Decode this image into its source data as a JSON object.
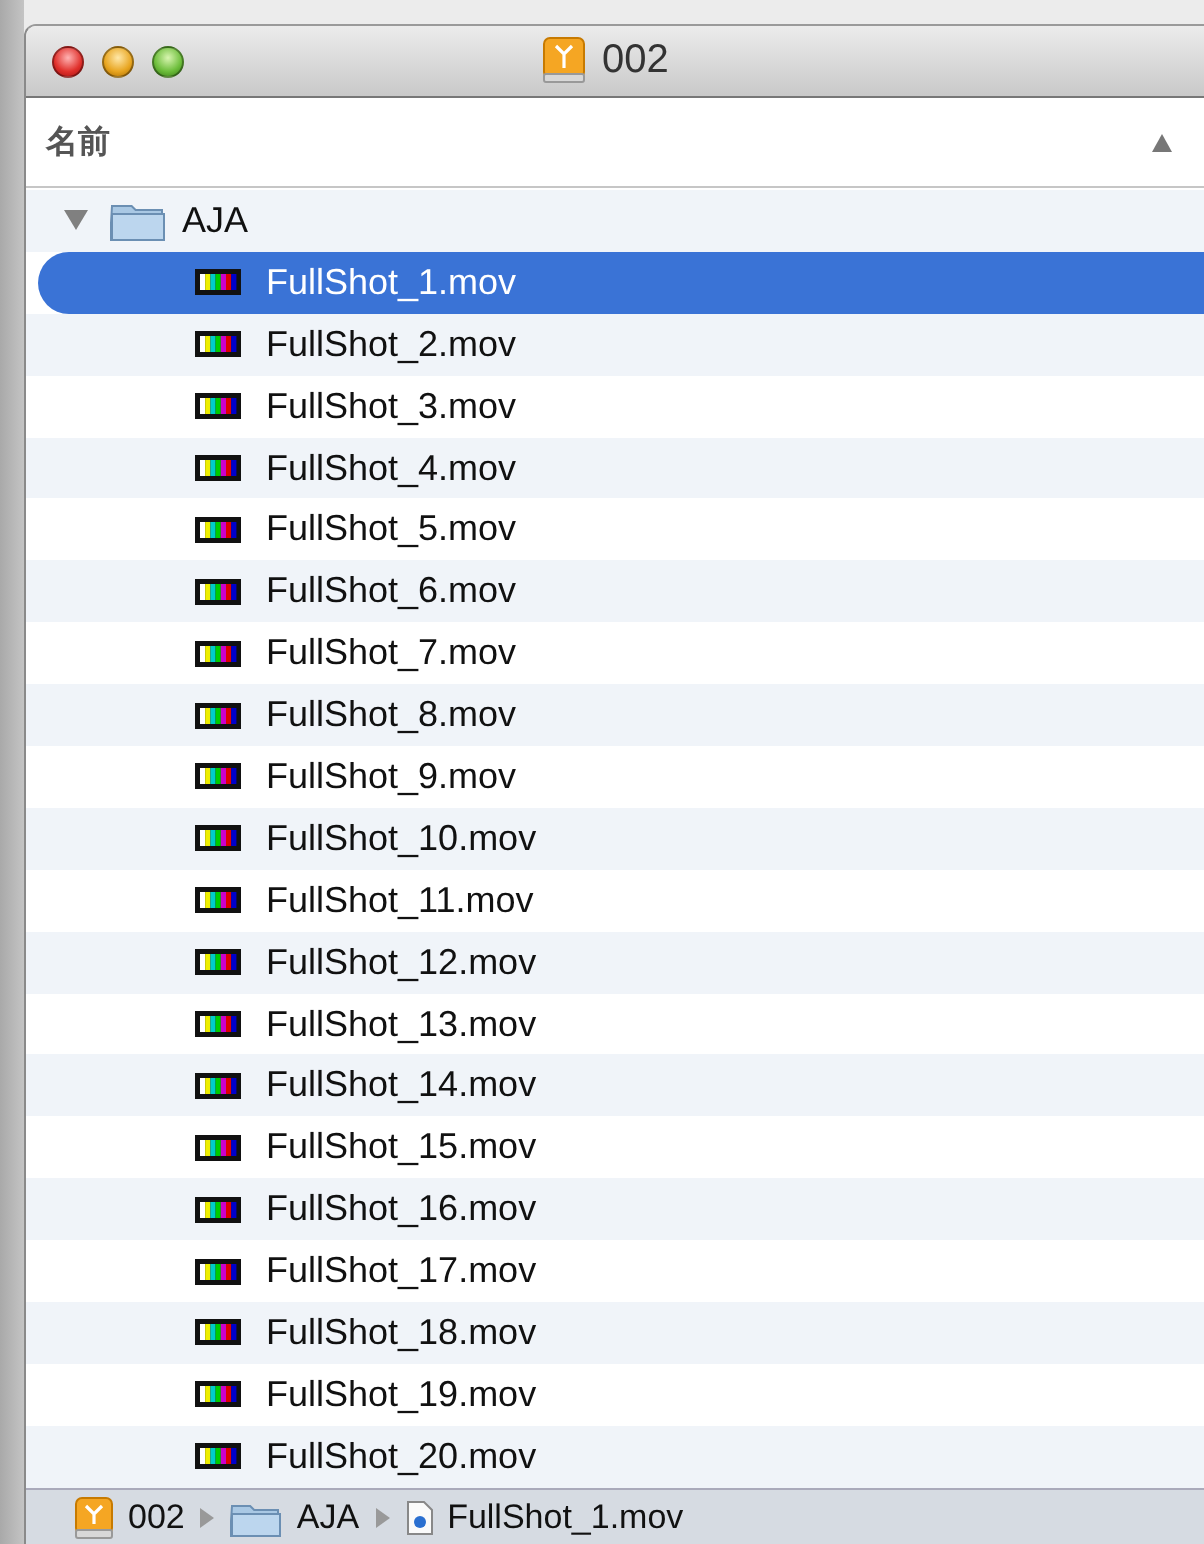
{
  "window": {
    "title": "002"
  },
  "list_header": {
    "label": "名前",
    "ascending": true
  },
  "tree": [
    {
      "kind": "folder",
      "name": "AJA",
      "expanded": true,
      "selected": false,
      "children": [
        {
          "kind": "movie",
          "name": "FullShot_1.mov",
          "selected": true
        },
        {
          "kind": "movie",
          "name": "FullShot_2.mov",
          "selected": false
        },
        {
          "kind": "movie",
          "name": "FullShot_3.mov",
          "selected": false
        },
        {
          "kind": "movie",
          "name": "FullShot_4.mov",
          "selected": false
        },
        {
          "kind": "movie",
          "name": "FullShot_5.mov",
          "selected": false
        },
        {
          "kind": "movie",
          "name": "FullShot_6.mov",
          "selected": false
        },
        {
          "kind": "movie",
          "name": "FullShot_7.mov",
          "selected": false
        },
        {
          "kind": "movie",
          "name": "FullShot_8.mov",
          "selected": false
        },
        {
          "kind": "movie",
          "name": "FullShot_9.mov",
          "selected": false
        },
        {
          "kind": "movie",
          "name": "FullShot_10.mov",
          "selected": false
        },
        {
          "kind": "movie",
          "name": "FullShot_11.mov",
          "selected": false
        },
        {
          "kind": "movie",
          "name": "FullShot_12.mov",
          "selected": false
        },
        {
          "kind": "movie",
          "name": "FullShot_13.mov",
          "selected": false
        },
        {
          "kind": "movie",
          "name": "FullShot_14.mov",
          "selected": false
        },
        {
          "kind": "movie",
          "name": "FullShot_15.mov",
          "selected": false
        },
        {
          "kind": "movie",
          "name": "FullShot_16.mov",
          "selected": false
        },
        {
          "kind": "movie",
          "name": "FullShot_17.mov",
          "selected": false
        },
        {
          "kind": "movie",
          "name": "FullShot_18.mov",
          "selected": false
        },
        {
          "kind": "movie",
          "name": "FullShot_19.mov",
          "selected": false
        },
        {
          "kind": "movie",
          "name": "FullShot_20.mov",
          "selected": false
        }
      ]
    }
  ],
  "path_bar": [
    {
      "kind": "drive",
      "name": "002"
    },
    {
      "kind": "folder",
      "name": "AJA"
    },
    {
      "kind": "document",
      "name": "FullShot_1.mov"
    }
  ]
}
